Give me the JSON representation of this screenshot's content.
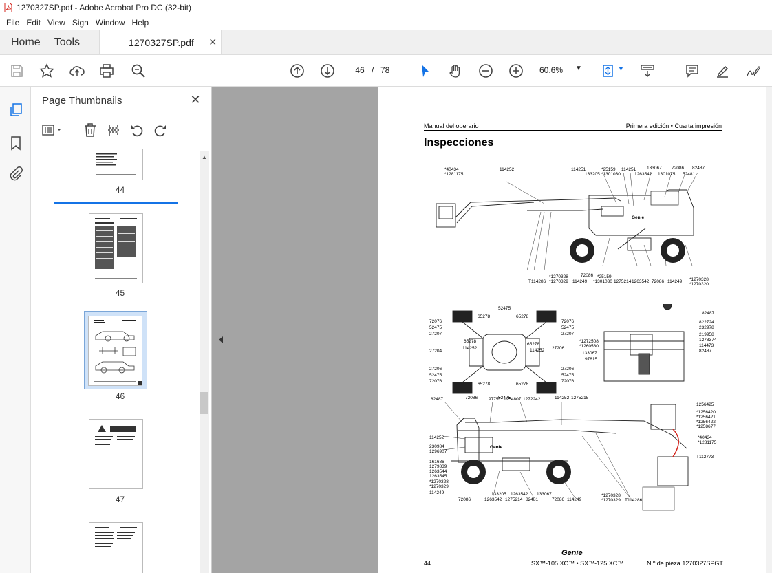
{
  "window": {
    "title": "1270327SP.pdf - Adobe Acrobat Pro DC (32-bit)"
  },
  "menu": [
    "File",
    "Edit",
    "View",
    "Sign",
    "Window",
    "Help"
  ],
  "tabs": {
    "home": "Home",
    "tools": "Tools",
    "document": "1270327SP.pdf"
  },
  "toolbar": {
    "current_page": "46",
    "page_separator": "/",
    "page_count": "78",
    "zoom": "60.6%"
  },
  "thumbnails_panel": {
    "title": "Page Thumbnails",
    "pages": [
      {
        "label": "44"
      },
      {
        "label": "45"
      },
      {
        "label": "46",
        "selected": true
      },
      {
        "label": "47"
      }
    ]
  },
  "document_page": {
    "header_left": "Manual del operario",
    "header_right": "Primera edición • Cuarta impresión",
    "title": "Inspecciones",
    "footer_page": "44",
    "footer_model": "SX™-105 XC™ • SX™-125 XC™",
    "footer_part": "N.º de pieza 1270327SPGT",
    "brand": "Genie",
    "diagram1_labels": {
      "top": [
        "*40434",
        "*1281175",
        "114252",
        "114251",
        "133205",
        "*25159",
        "*1301030",
        "114251",
        "1263542",
        "133067",
        "1301075",
        "72086",
        "52481",
        "82487"
      ],
      "bottom": [
        "T114286",
        "*1270328",
        "*1270329",
        "72086",
        "114249",
        "*25159",
        "*1301030",
        "1275214",
        "1263542",
        "72086",
        "114249",
        "*1270328",
        "*1270320"
      ]
    },
    "diagram2_labels": [
      "52475",
      "65278",
      "65278",
      "72076",
      "52475",
      "27207",
      "72076",
      "52475",
      "27207",
      "65278",
      "65278",
      "114252",
      "27204",
      "114252",
      "27206",
      "27206",
      "52475",
      "72076",
      "27206",
      "52475",
      "72076",
      "65278",
      "65278",
      "52475"
    ],
    "diagram3_labels": [
      "82487",
      "822724",
      "232978",
      "219958",
      "1278374",
      "*1272508",
      "*1260580",
      "114473",
      "133067",
      "82487",
      "97815"
    ],
    "diagram4_labels": {
      "top": [
        "82487",
        "72086",
        "97757",
        "1254807",
        "1272242",
        "114252",
        "1275215"
      ],
      "left": [
        "114252",
        "230984",
        "1296907",
        "161686",
        "1279839",
        "1263544",
        "1263545",
        "*1270328",
        "*1270329",
        "114249"
      ],
      "bottom": [
        "72086",
        "133205",
        "1263542",
        "1275214",
        "1263542",
        "82481",
        "133067",
        "72086",
        "114249",
        "*1270328",
        "*1270329",
        "T114286"
      ],
      "right": [
        "1256425",
        "*1256420",
        "*1256421",
        "*1256422",
        "*1258677",
        "*40434",
        "*1281175",
        "T112773"
      ]
    }
  },
  "colors": {
    "accent": "#1473e6",
    "tabbar": "#f0f0f0",
    "workspace": "#a4a4a4",
    "acrobat_red": "#d4261e"
  }
}
